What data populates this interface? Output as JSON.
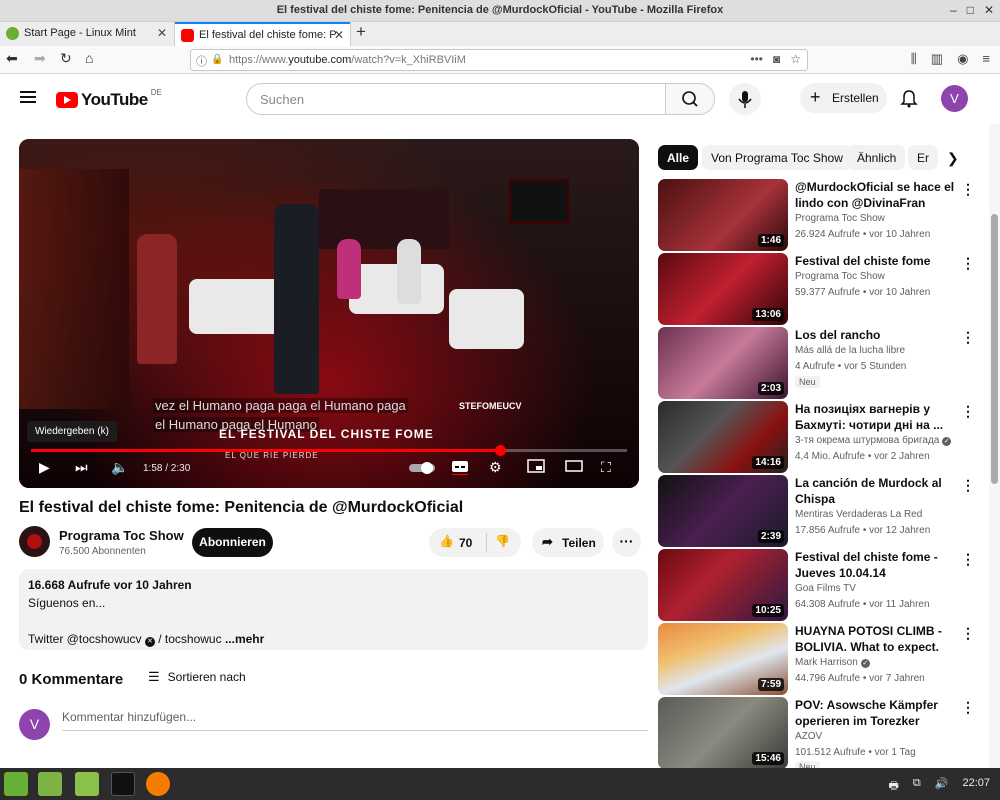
{
  "window": {
    "title": "El festival del chiste fome: Penitencia de @MurdockOficial - YouTube - Mozilla Firefox"
  },
  "tabs": [
    {
      "label": "Start Page - Linux Mint"
    },
    {
      "label": "El festival del chiste fome: P"
    }
  ],
  "url": {
    "prefix": "https://www.",
    "host": "youtube.com",
    "path": "/watch?v=k_XhiRBVIiM",
    "dots": "•••"
  },
  "yt": {
    "logo_text": "YouTube",
    "country": "DE",
    "search_placeholder": "Suchen",
    "create_label": "Erstellen",
    "avatar_letter": "V"
  },
  "player": {
    "subtitle1": "vez el Humano paga paga el Humano paga",
    "subtitle2": "el Humano paga el Humano",
    "watermark": "STEFOMEUCV",
    "tooltip": "Wiedergeben (k)",
    "banner": "EL FESTIVAL DEL CHISTE FOME",
    "banner_sub": "EL QUE RÍE PIERDE",
    "time": "1:58 / 2:30",
    "progress": 0.787
  },
  "video": {
    "title": "El festival del chiste fome: Penitencia de @MurdockOficial",
    "channel": "Programa Toc Show",
    "subscribers": "76.500 Abonnenten",
    "subscribe_label": "Abonnieren",
    "likes": "70",
    "share_label": "Teilen"
  },
  "description": {
    "meta": "16.668 Aufrufe  vor 10 Jahren",
    "line1": "Síguenos en...",
    "line2": "Twitter @tocshowucv",
    "line2b": " / tocshowuc",
    "more": "...mehr"
  },
  "comments": {
    "header": "0 Kommentare",
    "sort_label": "Sortieren nach",
    "avatar_letter": "V",
    "placeholder": "Kommentar hinzufügen..."
  },
  "chips": [
    "Alle",
    "Von Programa Toc Show",
    "Ähnlich",
    "Er"
  ],
  "recommendations": [
    {
      "title": "@MurdockOficial se hace el lindo con @DivinaFran",
      "channel": "Programa Toc Show",
      "stats": "26.924 Aufrufe • vor 10 Jahren",
      "duration": "1:46",
      "badge": ""
    },
    {
      "title": "Festival del chiste fome",
      "channel": "Programa Toc Show",
      "stats": "59.377 Aufrufe • vor 10 Jahren",
      "duration": "13:06",
      "badge": ""
    },
    {
      "title": "Los del rancho",
      "channel": "Más allá de la lucha libre",
      "stats": "4 Aufrufe • vor 5 Stunden",
      "duration": "2:03",
      "badge": "Neu"
    },
    {
      "title": "На позиціях вагнерів у Бахмуті: чотири дні на ...",
      "channel": "3-тя окрема штурмова бригада",
      "stats": "4,4 Mio. Aufrufe • vor 2 Jahren",
      "duration": "14:16",
      "badge": ""
    },
    {
      "title": "La canción de Murdock al Chispa",
      "channel": "Mentiras Verdaderas La Red",
      "stats": "17.856 Aufrufe • vor 12 Jahren",
      "duration": "2:39",
      "badge": ""
    },
    {
      "title": "Festival del chiste fome - Jueves 10.04.14",
      "channel": "Goa Films TV",
      "stats": "64.308 Aufrufe • vor 11 Jahren",
      "duration": "10:25",
      "badge": ""
    },
    {
      "title": "HUAYNA POTOSI CLIMB - BOLIVIA. What to expect.",
      "channel": "Mark Harrison",
      "stats": "44.796 Aufrufe • vor 7 Jahren",
      "duration": "7:59",
      "badge": ""
    },
    {
      "title": "POV: Asowsche Kämpfer operieren im Torezker Sektor",
      "channel": "AZOV",
      "stats": "101.512 Aufrufe • vor 1 Tag",
      "duration": "15:46",
      "badge": "Neu"
    }
  ],
  "taskbar": {
    "clock": "22:07"
  }
}
